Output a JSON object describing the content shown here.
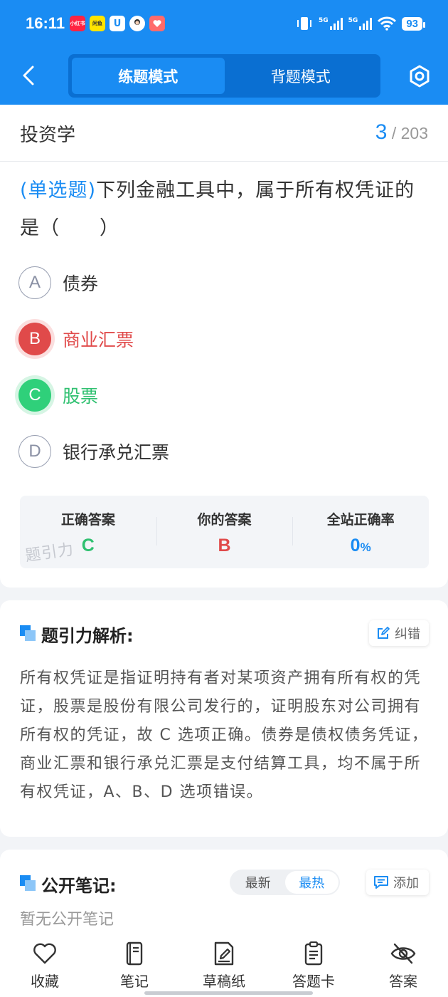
{
  "status_bar": {
    "time": "16:11",
    "apps": [
      {
        "name": "xiaohongshu-app-icon",
        "label": "小红书",
        "bg": "#ff2442",
        "fg": "#ffffff"
      },
      {
        "name": "xianyu-app-icon",
        "label": "闲鱼",
        "bg": "#ffe400",
        "fg": "#333333"
      },
      {
        "name": "shield-app-icon",
        "label": "U",
        "bg": "#ffffff",
        "fg": "#1a8cf3"
      },
      {
        "name": "avatar-app-icon",
        "label": "",
        "bg": "#ffffff",
        "fg": "#333333"
      },
      {
        "name": "love-app-icon",
        "label": "",
        "bg": "#ff6b6b",
        "fg": "#ffffff"
      }
    ],
    "signal1": "5G",
    "signal2": "5G",
    "battery": "93"
  },
  "header": {
    "modes": [
      "练题模式",
      "背题模式"
    ],
    "active_mode": 0
  },
  "question": {
    "subject": "投资学",
    "current": "3",
    "separator": "/",
    "total": "203",
    "type": "(单选题)",
    "text": "下列金融工具中，属于所有权凭证的是（　　）",
    "options": [
      {
        "letter": "A",
        "text": "债券",
        "state": "normal"
      },
      {
        "letter": "B",
        "text": "商业汇票",
        "state": "wrong"
      },
      {
        "letter": "C",
        "text": "股票",
        "state": "right"
      },
      {
        "letter": "D",
        "text": "银行承兑汇票",
        "state": "normal"
      }
    ]
  },
  "answer_box": {
    "correct_label": "正确答案",
    "correct_value": "C",
    "yours_label": "你的答案",
    "yours_value": "B",
    "rate_label": "全站正确率",
    "rate_value": "0",
    "rate_unit": "%",
    "watermark": "题引力"
  },
  "analysis": {
    "title": "题引力解析:",
    "fix_label": "纠错",
    "text": "所有权凭证是指证明持有者对某项资产拥有所有权的凭证，股票是股份有限公司发行的，证明股东对公司拥有所有权的凭证，故 C 选项正确。债券是债权债务凭证，商业汇票和银行承兑汇票是支付结算工具，均不属于所有权凭证，A、B、D 选项错误。"
  },
  "notes": {
    "title": "公开笔记:",
    "sort_options": [
      "最新",
      "最热"
    ],
    "active_sort": 1,
    "add_label": "添加",
    "empty_text": "暂无公开笔记"
  },
  "bottom_bar": {
    "items": [
      {
        "label": "收藏",
        "icon": "heart-icon"
      },
      {
        "label": "笔记",
        "icon": "notebook-icon"
      },
      {
        "label": "草稿纸",
        "icon": "draft-paper-icon"
      },
      {
        "label": "答题卡",
        "icon": "answer-sheet-icon"
      },
      {
        "label": "答案",
        "icon": "eye-off-icon"
      }
    ]
  },
  "colors": {
    "brand_blue": "#1a8cf3",
    "wrong_red": "#e04a4a",
    "right_green": "#2fc070"
  }
}
